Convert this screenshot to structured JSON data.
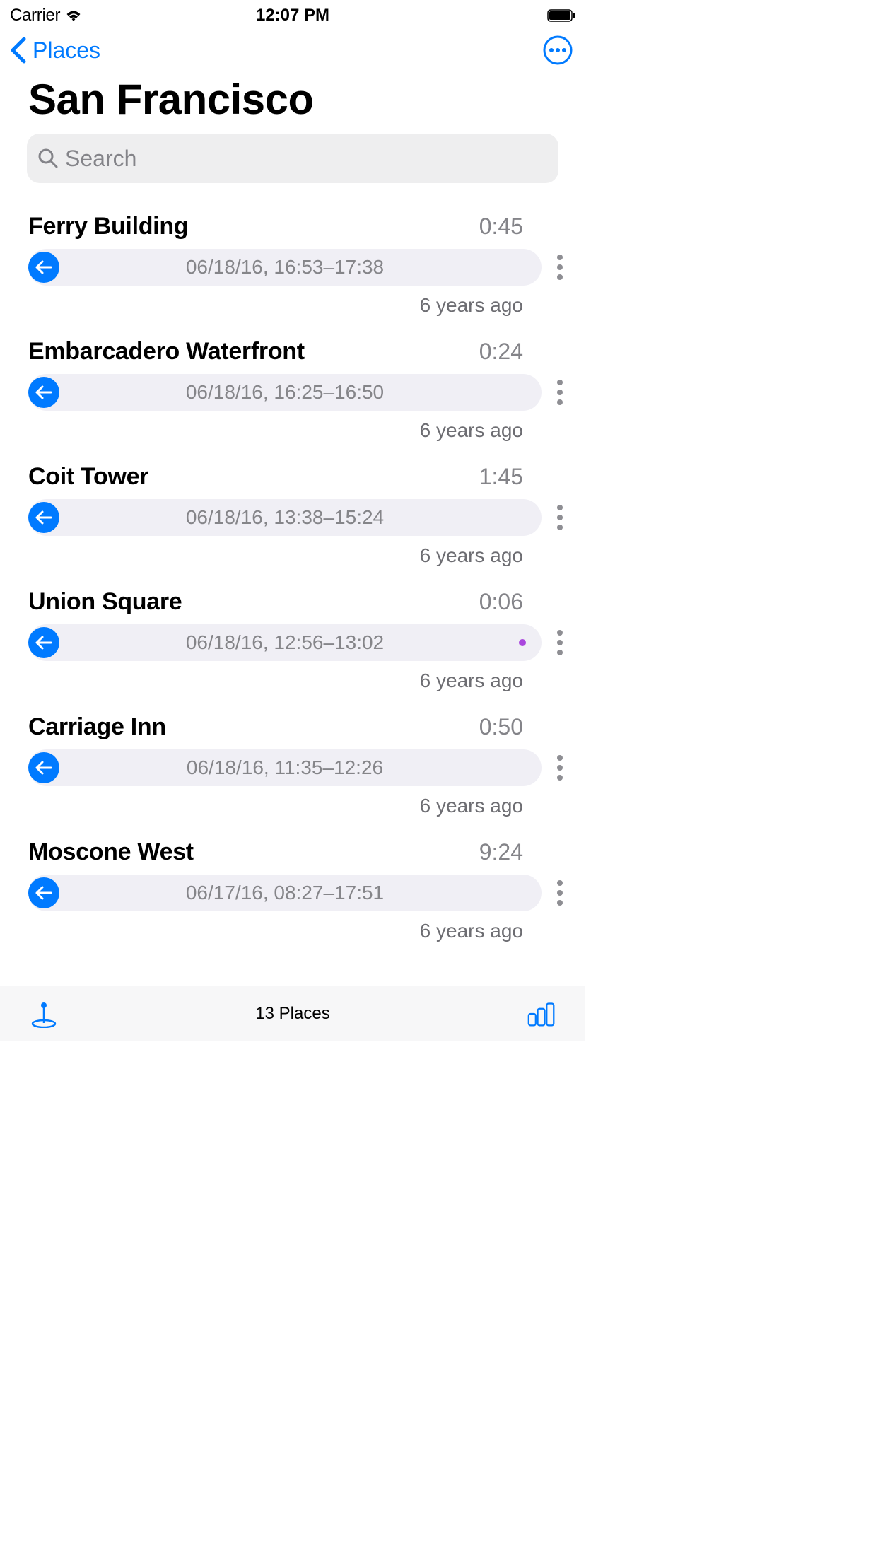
{
  "status_bar": {
    "carrier": "Carrier",
    "time": "12:07 PM"
  },
  "nav": {
    "back_label": "Places"
  },
  "page_title": "San Francisco",
  "search": {
    "placeholder": "Search"
  },
  "items": [
    {
      "title": "Ferry Building",
      "duration": "0:45",
      "timestamp": "06/18/16, 16:53–17:38",
      "ago": "6 years ago",
      "flagged": false
    },
    {
      "title": "Embarcadero Waterfront",
      "duration": "0:24",
      "timestamp": "06/18/16, 16:25–16:50",
      "ago": "6 years ago",
      "flagged": false
    },
    {
      "title": "Coit Tower",
      "duration": "1:45",
      "timestamp": "06/18/16, 13:38–15:24",
      "ago": "6 years ago",
      "flagged": false
    },
    {
      "title": "Union Square",
      "duration": "0:06",
      "timestamp": "06/18/16, 12:56–13:02",
      "ago": "6 years ago",
      "flagged": true
    },
    {
      "title": "Carriage Inn",
      "duration": "0:50",
      "timestamp": "06/18/16, 11:35–12:26",
      "ago": "6 years ago",
      "flagged": false
    },
    {
      "title": "Moscone West",
      "duration": "9:24",
      "timestamp": "06/17/16, 08:27–17:51",
      "ago": "6 years ago",
      "flagged": false
    }
  ],
  "toolbar": {
    "count_label": "13 Places"
  }
}
